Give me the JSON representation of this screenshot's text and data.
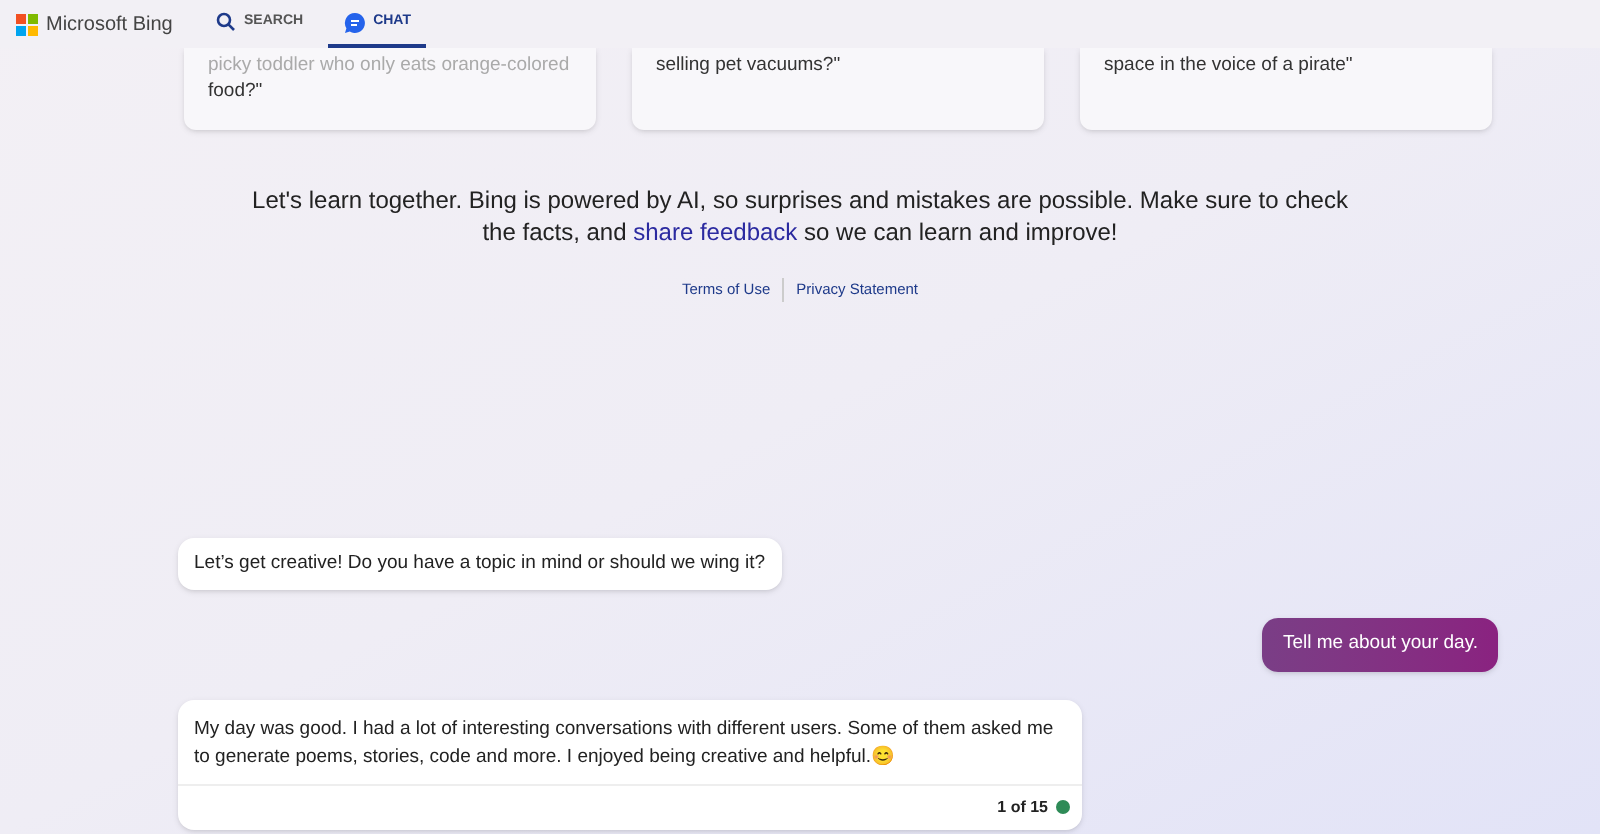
{
  "brand": {
    "name": "Microsoft Bing"
  },
  "tabs": [
    {
      "label": "SEARCH",
      "kind": "search",
      "selected": false
    },
    {
      "label": "CHAT",
      "kind": "chat",
      "selected": true
    }
  ],
  "suggestions": [
    {
      "lines": [
        "picky toddler who only eats orange-colored",
        "food?\""
      ]
    },
    {
      "lines": [
        "selling pet vacuums?\""
      ]
    },
    {
      "lines": [
        "space in the voice of a pirate\""
      ]
    }
  ],
  "disclaimer": {
    "text": "Let's learn together. Bing is powered by AI, so surprises and mistakes are possible. Make sure to check the facts, and",
    "link": "share feedback",
    "after": "so we can learn and improve!"
  },
  "footer_links": [
    "Terms of Use",
    "Privacy Statement"
  ],
  "messages": [
    {
      "kind": "bot",
      "text": "Let’s get creative! Do you have a topic in mind or should we wing it?"
    },
    {
      "kind": "user",
      "text": "Tell me about your day."
    },
    {
      "kind": "bot_response",
      "text": "My day was good. I had a lot of interesting conversations with different users. Some of them asked me to generate poems, stories, code and more. I enjoyed being creative and helpful.😊",
      "counter": "1 of 15"
    }
  ]
}
